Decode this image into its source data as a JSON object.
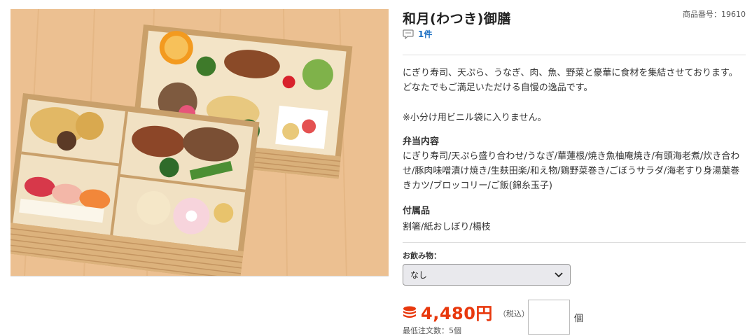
{
  "product": {
    "title": "和月(わつき)御膳",
    "code_label": "商品番号：19610",
    "review_count": "1件",
    "description": "にぎり寿司、天ぷら、うなぎ、肉、魚、野菜と豪華に食材を集結させております。どなたでもご満足いただける自慢の逸品です。",
    "note": "※小分け用ビニル袋に入りません。",
    "image_alt": "和月(わつき)御膳"
  },
  "bento": {
    "heading": "弁当内容",
    "items": "にぎり寿司/天ぷら盛り合わせ/うなぎ/華蓮根/焼き魚柚庵焼き/有頭海老煮/炊き合わせ/豚肉味噌漬け焼き/生麸田楽/和え物/鶏野菜巻き/ごぼうサラダ/海老すり身湯葉巻きカツ/ブロッコリー/ご飯(錦糸玉子)"
  },
  "accessories": {
    "heading": "付属品",
    "items": "割箸/紙おしぼり/楊枝"
  },
  "drink": {
    "label": "お飲み物：",
    "selected": "なし"
  },
  "price": {
    "amount": "4,480円",
    "tax_note": "（税込）",
    "min_order": "最低注文数：5個",
    "quantity_value": "",
    "unit": "個"
  },
  "colors": {
    "price": "#e8380d",
    "link": "#1a6ec2",
    "wood": "#e9b988"
  },
  "icons": {
    "review": "speech-bubble-icon",
    "price": "coin-stack-icon",
    "select": "chevron-down-icon"
  }
}
